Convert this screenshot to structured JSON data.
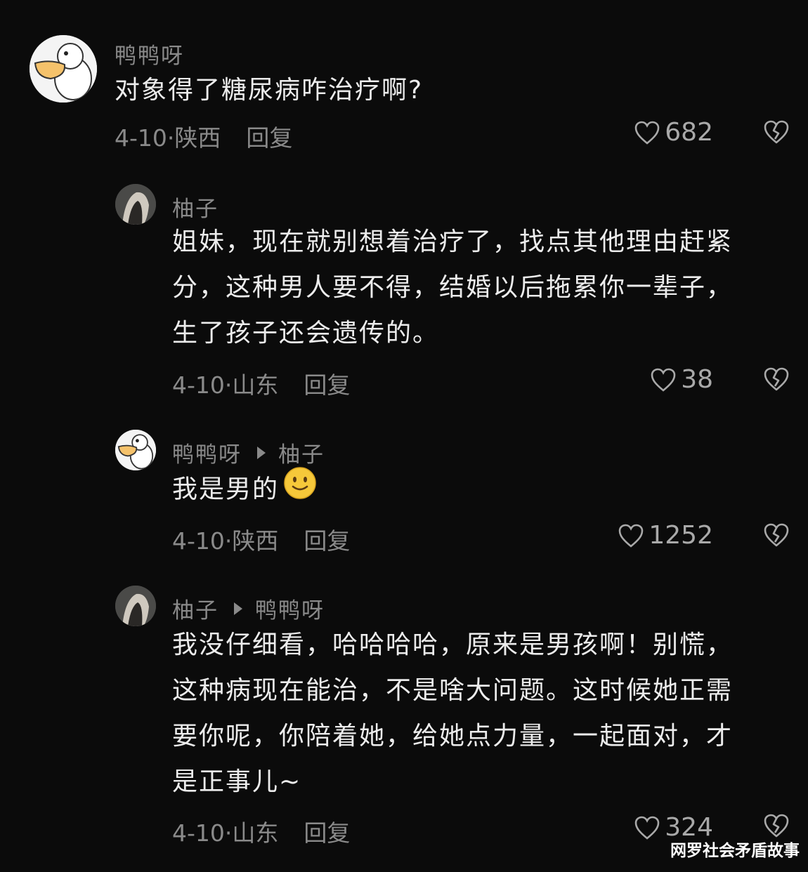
{
  "comments": [
    {
      "author": "鸭鸭呀",
      "reply_to": "",
      "text": "对象得了糖尿病咋治疗啊?",
      "date_location": "4-10·陕西",
      "reply_label": "回复",
      "likes": "682"
    },
    {
      "author": "柚子",
      "reply_to": "",
      "text": "姐妹，现在就别想着治疗了，找点其他理由赶紧分，这种男人要不得，结婚以后拖累你一辈子，生了孩子还会遗传的。",
      "date_location": "4-10·山东",
      "reply_label": "回复",
      "likes": "38"
    },
    {
      "author": "鸭鸭呀",
      "reply_to": "柚子",
      "text": "我是男的",
      "date_location": "4-10·陕西",
      "reply_label": "回复",
      "likes": "1252"
    },
    {
      "author": "柚子",
      "reply_to": "鸭鸭呀",
      "text": "我没仔细看，哈哈哈哈，原来是男孩啊！别慌，这种病现在能治，不是啥大问题。这时候她正需要你呢，你陪着她，给她点力量，一起面对，才是正事儿~",
      "date_location": "4-10·山东",
      "reply_label": "回复",
      "likes": "324"
    }
  ],
  "icons": {
    "like": "heart-outline-icon",
    "dislike": "broken-heart-icon",
    "smile": "smiling-face-emoji",
    "reply_arrow": "play-arrow-icon"
  },
  "watermark": "网罗社会矛盾故事"
}
